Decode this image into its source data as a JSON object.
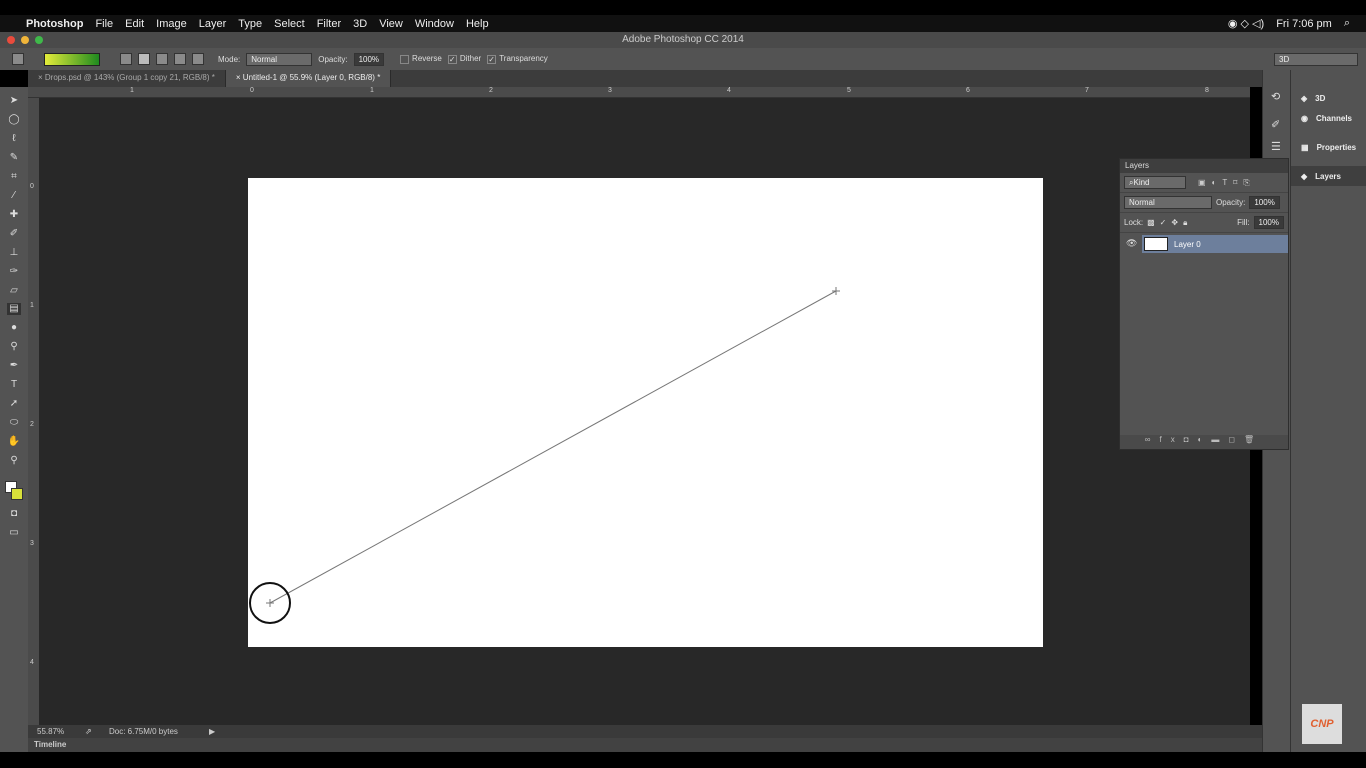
{
  "menubar": {
    "app": "Photoshop",
    "items": [
      "File",
      "Edit",
      "Image",
      "Layer",
      "Type",
      "Select",
      "Filter",
      "3D",
      "View",
      "Window",
      "Help"
    ],
    "clock": "Fri 7:06 pm"
  },
  "window": {
    "title": "Adobe Photoshop CC 2014"
  },
  "options": {
    "mode_label": "Mode:",
    "mode_value": "Normal",
    "opacity_label": "Opacity:",
    "opacity_value": "100%",
    "reverse": "Reverse",
    "dither": "Dither",
    "transparency": "Transparency",
    "workspace": "3D"
  },
  "tabs": [
    {
      "label": "Drops.psd @ 143% (Group 1 copy 21, RGB/8) *"
    },
    {
      "label": "Untitled-1 @ 55.9% (Layer 0, RGB/8) *"
    }
  ],
  "ruler": {
    "h": [
      "1",
      "0",
      "1",
      "2",
      "3",
      "4",
      "5",
      "6",
      "7",
      "8"
    ],
    "v": [
      "0",
      "1",
      "2",
      "3",
      "4"
    ]
  },
  "status": {
    "zoom": "55.87%",
    "doc": "Doc: 6.75M/0 bytes"
  },
  "timeline": "Timeline",
  "dock": [
    "3D",
    "Channels",
    "Properties",
    "Layers"
  ],
  "layers_panel": {
    "title": "Layers",
    "filter": "Kind",
    "blend": "Normal",
    "opacity_label": "Opacity:",
    "opacity": "100%",
    "lock_label": "Lock:",
    "fill_label": "Fill:",
    "fill": "100%",
    "layers": [
      {
        "name": "Layer 0"
      }
    ]
  },
  "watermark": "CNP",
  "gradient_colors": [
    "#e4ec3a",
    "#1f8a1f"
  ]
}
